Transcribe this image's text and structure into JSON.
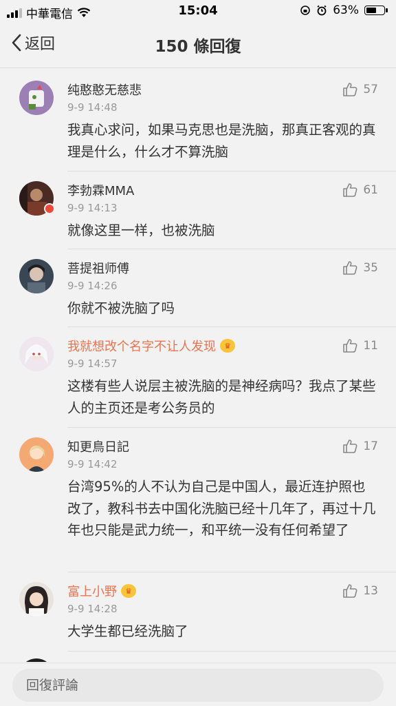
{
  "status_bar": {
    "carrier": "中華電信",
    "time": "15:04",
    "battery": "63%",
    "battery_level": 0.63
  },
  "nav": {
    "back_label": "返回",
    "title": "150 條回復"
  },
  "comments": [
    {
      "name": "纯憨憨无慈悲",
      "time": "9-9 14:48",
      "likes": "57",
      "text": "我真心求问，如果马克思也是洗脑，那真正客观的真理是什么，什么才不算洗脑"
    },
    {
      "name": "李勃霖MMA",
      "time": "9-9 14:13",
      "likes": "61",
      "text": "就像这里一样，也被洗脑"
    },
    {
      "name": "菩提祖师傅",
      "time": "9-9 14:26",
      "likes": "35",
      "text": "你就不被洗脑了吗"
    },
    {
      "name": "我就想改个名字不让人发现",
      "time": "9-9 14:57",
      "likes": "11",
      "text": "这楼有些人说层主被洗脑的是神经病吗？我点了某些人的主页还是考公务员的"
    },
    {
      "name": "知更鳥日記",
      "time": "9-9 14:42",
      "likes": "17",
      "text": "台湾95%的人不认为自己是中国人，最近连护照也改了，教科书去中国化洗脑已经十几年了，再过十几年也只能是武力统一，和平统一没有任何希望了"
    },
    {
      "name": "富上小野",
      "time": "9-9 14:28",
      "likes": "13",
      "text": "大学生都已经洗脑了"
    }
  ],
  "composer": {
    "placeholder": "回復評論"
  },
  "colors": {
    "vip_name": "#eb7350",
    "background": "#f2f2f2"
  }
}
